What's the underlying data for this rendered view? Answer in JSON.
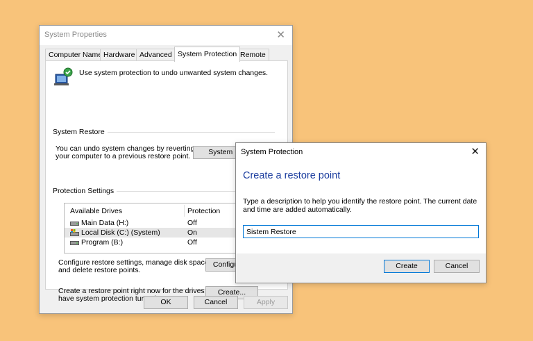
{
  "system_properties": {
    "title": "System Properties",
    "tabs": [
      "Computer Name",
      "Hardware",
      "Advanced",
      "System Protection",
      "Remote"
    ],
    "active_tab": "System Protection",
    "info_text": "Use system protection to undo unwanted system changes.",
    "system_restore": {
      "group_label": "System Restore",
      "description_line1": "You can undo system changes by reverting",
      "description_line2": "your computer to a previous restore point.",
      "button_label": "System Restore..."
    },
    "protection_settings": {
      "group_label": "Protection Settings",
      "columns": [
        "Available Drives",
        "Protection"
      ],
      "drives": [
        {
          "name": "Main Data (H:)",
          "protection": "Off",
          "icon": "hard-drive-icon"
        },
        {
          "name": "Local Disk (C:) (System)",
          "protection": "On",
          "icon": "system-drive-icon"
        },
        {
          "name": "Program (B:)",
          "protection": "Off",
          "icon": "hard-drive-icon"
        }
      ],
      "configure_text_line1": "Configure restore settings, manage disk space,",
      "configure_text_line2": "and delete restore points.",
      "configure_button": "Configure...",
      "create_text_line1": "Create a restore point right now for the drives that",
      "create_text_line2": "have system protection turned on.",
      "create_button": "Create..."
    },
    "buttons": {
      "ok": "OK",
      "cancel": "Cancel",
      "apply": "Apply"
    }
  },
  "dialog": {
    "title": "System Protection",
    "heading": "Create a restore point",
    "description": "Type a description to help you identify the restore point. The current date and time are added automatically.",
    "input_value": "Sistem Restore",
    "buttons": {
      "create": "Create",
      "cancel": "Cancel"
    }
  },
  "colors": {
    "background": "#F8C37A",
    "heading": "#1A3C9E",
    "accent": "#0078D7"
  }
}
